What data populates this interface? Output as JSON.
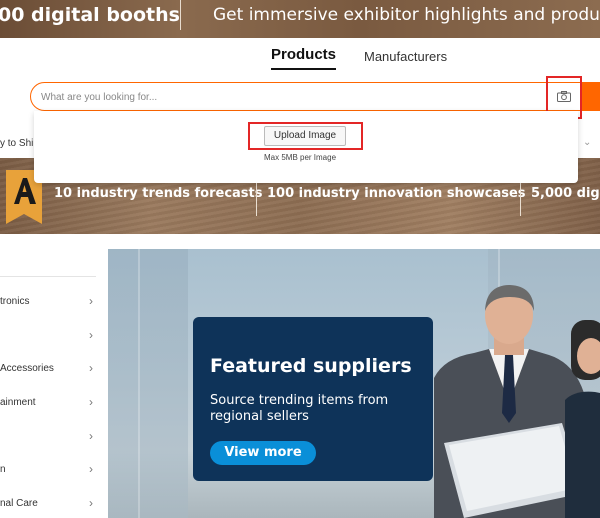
{
  "top_banner": {
    "left_text": "00 digital booths",
    "right_text": "Get immersive exhibitor highlights and produc"
  },
  "tabs": [
    {
      "label": "Products",
      "active": true
    },
    {
      "label": "Manufacturers",
      "active": false
    }
  ],
  "search": {
    "placeholder": "What are you looking for...",
    "value": "",
    "camera_icon": "camera-icon"
  },
  "upload_panel": {
    "button_label": "Upload Image",
    "hint": "Max 5MB per Image"
  },
  "ship_strip": {
    "text": "y to Shi"
  },
  "promo_banner": {
    "items": [
      "10 industry trends forecasts",
      "100 industry innovation showcases",
      "5,000 digi"
    ],
    "logo_icon": "a-logo-icon"
  },
  "categories": [
    {
      "label": "tronics"
    },
    {
      "label": ""
    },
    {
      "label": " Accessories"
    },
    {
      "label": "ainment"
    },
    {
      "label": ""
    },
    {
      "label": "n"
    },
    {
      "label": "nal Care"
    }
  ],
  "hero": {
    "heading": "Featured suppliers",
    "subheading": "Source trending items from regional sellers",
    "button_label": "View more"
  },
  "colors": {
    "accent_orange": "#ff6600",
    "highlight_red": "#e32626",
    "card_navy": "#0e3359",
    "button_blue": "#0a8fd8"
  }
}
